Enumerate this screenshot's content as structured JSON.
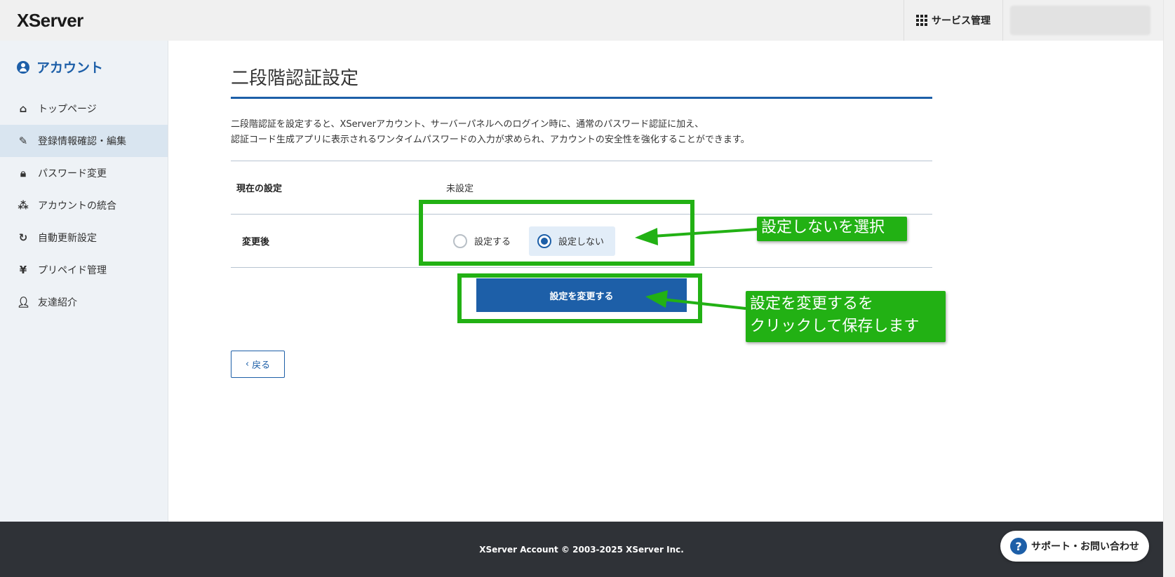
{
  "header": {
    "logo": "XServer",
    "services_label": "サービス管理"
  },
  "sidebar": {
    "title": "アカウント",
    "items": [
      {
        "label": "トップページ",
        "icon": "home-icon"
      },
      {
        "label": "登録情報確認・編集",
        "icon": "edit-icon",
        "active": true
      },
      {
        "label": "パスワード変更",
        "icon": "lock-icon"
      },
      {
        "label": "アカウントの統合",
        "icon": "merge-icon"
      },
      {
        "label": "自動更新設定",
        "icon": "refresh-icon"
      },
      {
        "label": "プリペイド管理",
        "icon": "yen-icon"
      },
      {
        "label": "友達紹介",
        "icon": "person-icon"
      }
    ]
  },
  "main": {
    "title": "二段階認証設定",
    "description_line1": "二段階認証を設定すると、XServerアカウント、サーバーパネルへのログイン時に、通常のパスワード認証に加え、",
    "description_line2": "認証コード生成アプリに表示されるワンタイムパスワードの入力が求められ、アカウントの安全性を強化することができます。",
    "current_label": "現在の設定",
    "current_value": "未設定",
    "after_label": "変更後",
    "radio_options": [
      "設定する",
      "設定しない"
    ],
    "selected_option": "設定しない",
    "submit_label": "設定を変更する",
    "back_label": "戻る"
  },
  "annotations": {
    "callout1": "設定しないを選択",
    "callout2_line1": "設定を変更するを",
    "callout2_line2": "クリックして保存します",
    "highlight_color": "#22b114"
  },
  "footer": {
    "copyright": "XServer Account © 2003-2025 XServer Inc.",
    "support_label": "サポート・お問い合わせ"
  },
  "colors": {
    "brand": "#1d5fa8",
    "footer_bg": "#2f3237",
    "sidebar_bg": "#eef2f6"
  }
}
